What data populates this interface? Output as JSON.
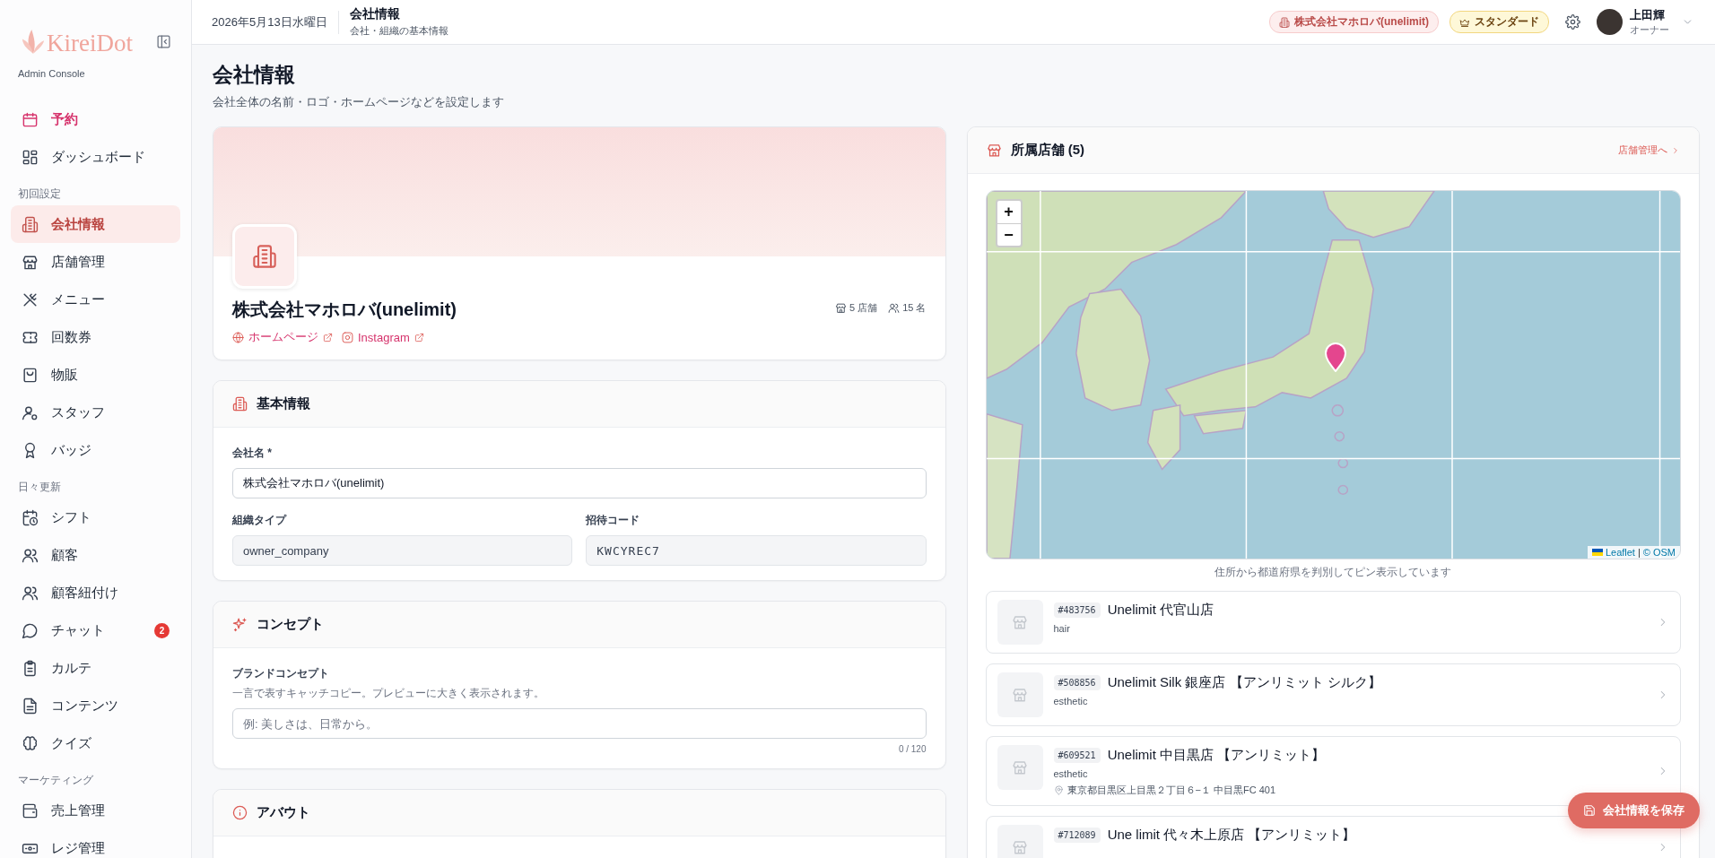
{
  "sidebar": {
    "logo": "KireiDot",
    "subtitle": "Admin Console",
    "groups": [
      {
        "items": [
          {
            "label": "予約",
            "kind": "featured",
            "selected": false
          },
          {
            "label": "ダッシュボード",
            "kind": "plain",
            "selected": false
          }
        ]
      },
      {
        "heading": "初回設定",
        "items": [
          {
            "label": "会社情報",
            "kind": "plain",
            "selected": true
          },
          {
            "label": "店舗管理",
            "kind": "plain",
            "selected": false
          },
          {
            "label": "メニュー",
            "kind": "plain",
            "selected": false
          },
          {
            "label": "回数券",
            "kind": "plain",
            "selected": false
          },
          {
            "label": "物販",
            "kind": "plain",
            "selected": false
          },
          {
            "label": "スタッフ",
            "kind": "plain",
            "selected": false
          },
          {
            "label": "バッジ",
            "kind": "plain",
            "selected": false
          }
        ]
      },
      {
        "heading": "日々更新",
        "items": [
          {
            "label": "シフト",
            "kind": "plain",
            "selected": false
          },
          {
            "label": "顧客",
            "kind": "plain",
            "selected": false
          },
          {
            "label": "顧客紐付け",
            "kind": "plain",
            "selected": false
          },
          {
            "label": "チャット",
            "kind": "plain",
            "selected": false,
            "badge": "2"
          },
          {
            "label": "カルテ",
            "kind": "plain",
            "selected": false
          },
          {
            "label": "コンテンツ",
            "kind": "plain",
            "selected": false
          },
          {
            "label": "クイズ",
            "kind": "plain",
            "selected": false
          }
        ]
      },
      {
        "heading": "マーケティング",
        "items": [
          {
            "label": "売上管理",
            "kind": "plain",
            "selected": false
          },
          {
            "label": "レジ管理",
            "kind": "plain",
            "selected": false
          }
        ]
      }
    ]
  },
  "header": {
    "date": "2026年5月13日水曜日",
    "title": "会社情報",
    "subtitle": "会社・組織の基本情報",
    "organization": "株式会社マホロバ(unelimit)",
    "plan": "スタンダード",
    "user": {
      "name": "上田輝",
      "role": "オーナー"
    }
  },
  "page": {
    "title": "会社情報",
    "description": "会社全体の名前・ロゴ・ホームページなどを設定します"
  },
  "profile": {
    "name": "株式会社マホロバ(unelimit)",
    "links": [
      "ホームページ",
      "Instagram"
    ],
    "stats": [
      "5 店舗",
      "15 名"
    ]
  },
  "sections": [
    {
      "title": "基本情報",
      "rows": [
        [
          {
            "label": "会社名 *",
            "value": "株式会社マホロバ(unelimit)",
            "kind": "text",
            "disabled": false
          }
        ],
        [
          {
            "label": "組織タイプ",
            "value": "owner_company",
            "kind": "text",
            "disabled": true
          },
          {
            "label": "招待コード",
            "value": "KWCYREC7",
            "kind": "code",
            "disabled": true
          }
        ]
      ]
    },
    {
      "title": "コンセプト",
      "rows": [
        [
          {
            "label": "ブランドコンセプト",
            "hint": "一言で表すキャッチコピー。プレビューに大きく表示されます。",
            "placeholder": "例: 美しさは、日常から。",
            "counter": "0 / 120",
            "kind": "text",
            "disabled": false
          }
        ]
      ]
    },
    {
      "title": "アバウト"
    }
  ],
  "stores": {
    "title": "所属店舗 (5)",
    "manage_link": "店舗管理へ",
    "map": {
      "zoom_in": "+",
      "zoom_out": "−",
      "attribution_link": "Leaflet",
      "attribution_separator": "|",
      "attribution_source": "© OSM"
    },
    "caption": "住所から都道府県を判別してピン表示しています",
    "items": [
      {
        "id": "#483756",
        "name": "Unelimit 代官山店",
        "category": "hair"
      },
      {
        "id": "#508856",
        "name": "Unelimit Silk 銀座店 【アンリミット シルク】",
        "category": "esthetic"
      },
      {
        "id": "#609521",
        "name": "Unelimit 中目黒店 【アンリミット】",
        "category": "esthetic",
        "address": "東京都目黒区上目黒２丁目６−１ 中目黒FC 401"
      },
      {
        "id": "#712089",
        "name": "Une limit 代々木上原店 【アンリミット】"
      }
    ]
  },
  "save_button": "会社情報を保存"
}
